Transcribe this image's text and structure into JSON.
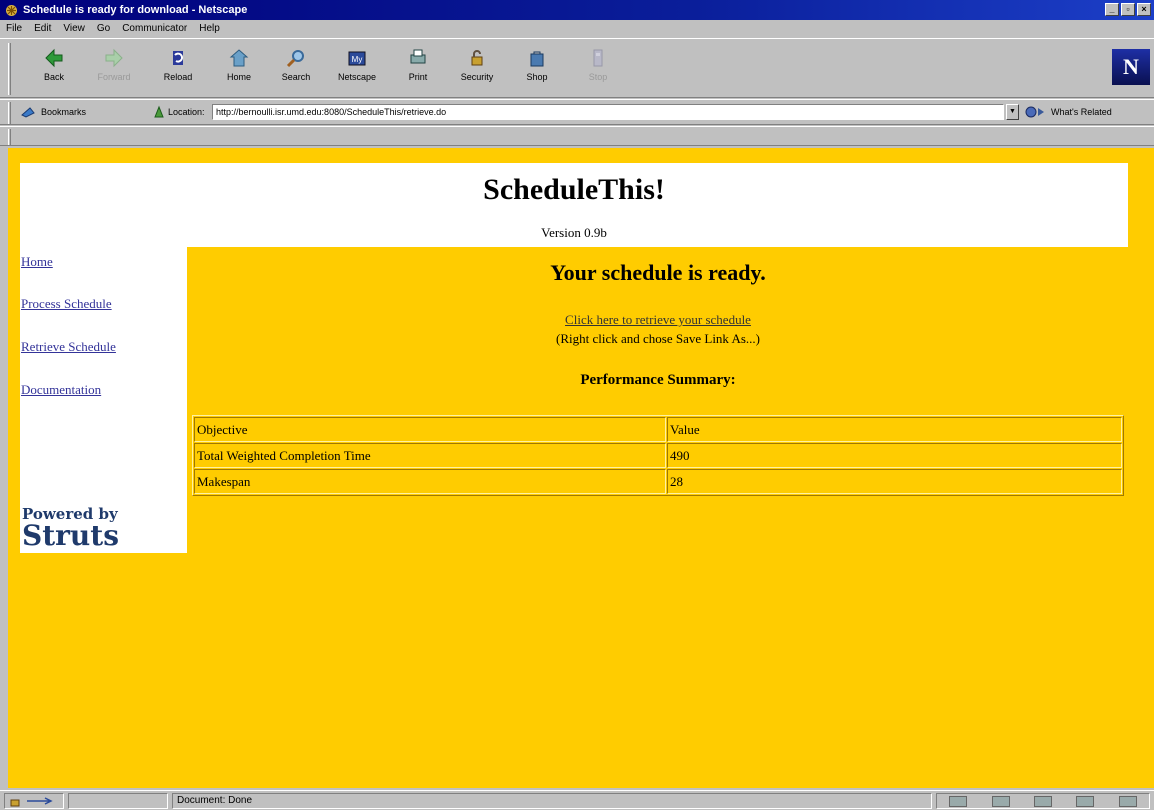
{
  "window": {
    "title": "Schedule is ready for download - Netscape",
    "controls": [
      "_",
      "▫",
      "×"
    ]
  },
  "menu": [
    "File",
    "Edit",
    "View",
    "Go",
    "Communicator",
    "Help"
  ],
  "toolbar": {
    "buttons": [
      {
        "label": "Back",
        "icon": "back-arrow-icon",
        "enabled": true
      },
      {
        "label": "Forward",
        "icon": "forward-arrow-icon",
        "enabled": false
      },
      {
        "label": "Reload",
        "icon": "reload-icon",
        "enabled": true
      },
      {
        "label": "Home",
        "icon": "home-icon",
        "enabled": true
      },
      {
        "label": "Search",
        "icon": "search-icon",
        "enabled": true
      },
      {
        "label": "Netscape",
        "icon": "netscape-icon",
        "enabled": true
      },
      {
        "label": "Print",
        "icon": "print-icon",
        "enabled": true
      },
      {
        "label": "Security",
        "icon": "security-lock-icon",
        "enabled": true
      },
      {
        "label": "Shop",
        "icon": "shop-bag-icon",
        "enabled": true
      },
      {
        "label": "Stop",
        "icon": "stop-icon",
        "enabled": false
      }
    ],
    "logo": "N"
  },
  "location_bar": {
    "bookmarks_label": "Bookmarks",
    "location_label": "Location:",
    "url": "http://bernoulli.isr.umd.edu:8080/ScheduleThis/retrieve.do",
    "whats_related": "What's Related"
  },
  "page": {
    "site_title": "ScheduleThis!",
    "version": "Version 0.9b",
    "nav": [
      "Home",
      "Process Schedule",
      "Retrieve Schedule",
      "Documentation"
    ],
    "powered_by": {
      "line1": "Powered by",
      "line2": "Struts"
    },
    "heading": "Your schedule is ready.",
    "retrieve_link": "Click here to retrieve your schedule",
    "save_hint": "(Right click and chose Save Link As...)",
    "summary_heading": "Performance Summary:",
    "table": {
      "rows": [
        [
          "Objective",
          "Value"
        ],
        [
          "Total Weighted Completion Time",
          "490"
        ],
        [
          "Makespan",
          "28"
        ]
      ]
    },
    "colors": {
      "background": "#ffcc00",
      "link": "#333399"
    }
  },
  "status_bar": {
    "text": "Document: Done"
  }
}
